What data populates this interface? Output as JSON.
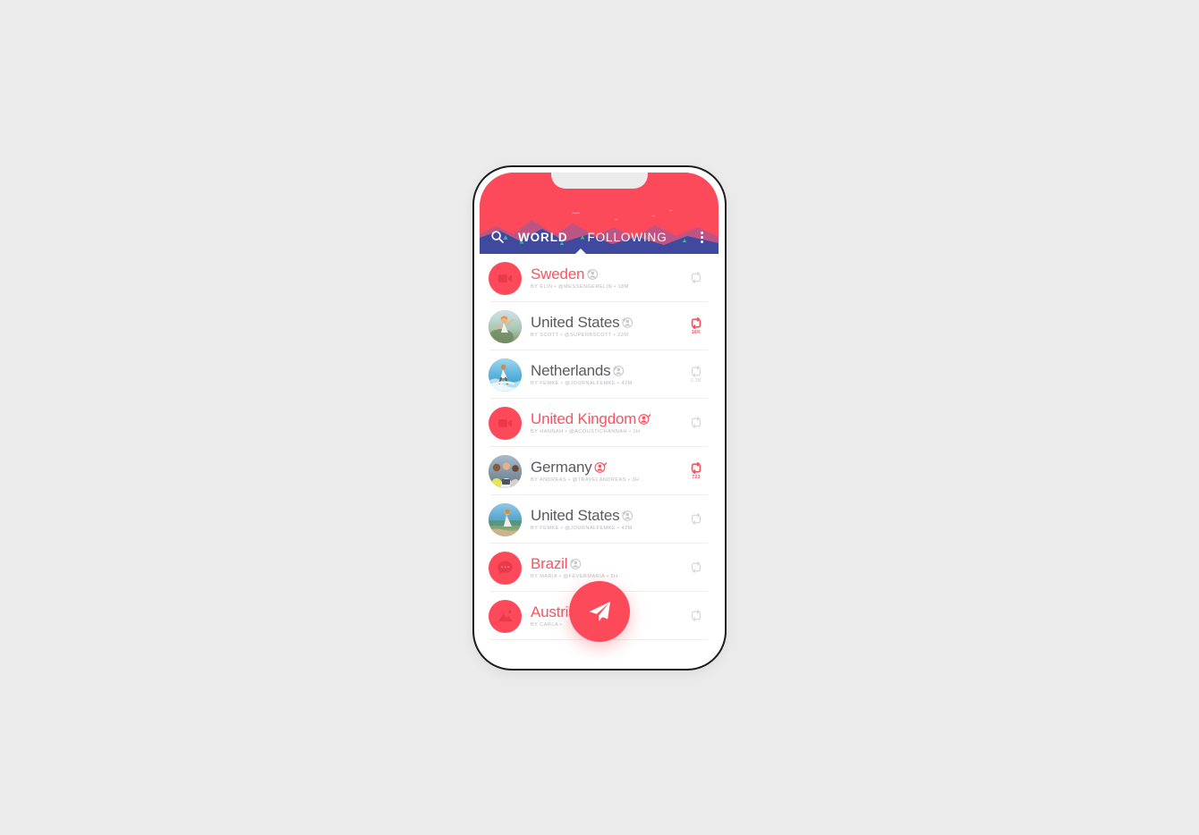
{
  "theme": {
    "accent_red": "#fc4a5a",
    "title_red": "#fc5260",
    "title_grey": "#5b5b5f",
    "subtitle_grey": "#b9b9bd",
    "mountain_back": "#b85c8e",
    "mountain_front": "#3f4a9e",
    "sun": "#f7a64a",
    "page_bg": "#ebebeb"
  },
  "header": {
    "search_icon": "search-icon",
    "more_icon": "more-vertical-icon",
    "tabs": [
      {
        "label": "WORLD",
        "active": true
      },
      {
        "label": "FOLLOWING",
        "active": false
      }
    ]
  },
  "fab": {
    "icon": "paper-plane-icon",
    "label": "Compose"
  },
  "feed": {
    "rows": [
      {
        "title": "Sweden",
        "title_color": "red",
        "avatar_type": "icon",
        "avatar_icon": "video-camera-icon",
        "follow_badge": "add-person-icon",
        "follow_badge_state": "not-following",
        "subtitle": "BY ELIN • @MESSENGERELIN • 18M",
        "author": "ELIN",
        "handle": "@MESSENGERELIN",
        "time": "18M",
        "retweet_active": false,
        "retweet_count": ""
      },
      {
        "title": "United States",
        "title_color": "grey",
        "avatar_type": "photo",
        "avatar_icon": "photo-hiker-avatar",
        "follow_badge": "add-person-icon",
        "follow_badge_state": "not-following",
        "subtitle": "BY SCOTT • @SUPERBSCOTT • 22M",
        "author": "SCOTT",
        "handle": "@SUPERBSCOTT",
        "time": "22M",
        "retweet_active": true,
        "retweet_count": "16K"
      },
      {
        "title": "Netherlands",
        "title_color": "grey",
        "avatar_type": "photo",
        "avatar_icon": "photo-surfer-avatar",
        "follow_badge": "add-person-icon",
        "follow_badge_state": "not-following",
        "subtitle": "BY FEMKE • @JOURNALFEMKE • 42M",
        "author": "FEMKE",
        "handle": "@JOURNALFEMKE",
        "time": "42M",
        "retweet_active": false,
        "retweet_count": "2.2K"
      },
      {
        "title": "United Kingdom",
        "title_color": "red",
        "avatar_type": "icon",
        "avatar_icon": "video-camera-icon",
        "follow_badge": "person-check-icon",
        "follow_badge_state": "following",
        "subtitle": "BY HANNAH • @ACOUSTICHANNAH • 1H",
        "author": "HANNAH",
        "handle": "@ACOUSTICHANNAH",
        "time": "1H",
        "retweet_active": false,
        "retweet_count": ""
      },
      {
        "title": "Germany",
        "title_color": "grey",
        "avatar_type": "photo",
        "avatar_icon": "photo-friends-avatar",
        "follow_badge": "person-check-icon",
        "follow_badge_state": "following",
        "subtitle": "BY ANDREAS • @TRAVELANDREAS • 3H",
        "author": "ANDREAS",
        "handle": "@TRAVELANDREAS",
        "time": "3H",
        "retweet_active": true,
        "retweet_count": "723"
      },
      {
        "title": "United States",
        "title_color": "grey",
        "avatar_type": "photo",
        "avatar_icon": "photo-beach-avatar",
        "follow_badge": "add-person-icon",
        "follow_badge_state": "not-following",
        "subtitle": "BY FEMKE • @JOURNALFEMKE • 42M",
        "author": "FEMKE",
        "handle": "@JOURNALFEMKE",
        "time": "42M",
        "retweet_active": false,
        "retweet_count": ""
      },
      {
        "title": "Brazil",
        "title_color": "red",
        "avatar_type": "icon",
        "avatar_icon": "chat-bubble-icon",
        "follow_badge": "add-person-icon",
        "follow_badge_state": "not-following",
        "subtitle": "BY MARIA • @FEVERMARIA • 5H",
        "author": "MARIA",
        "handle": "@FEVERMARIA",
        "time": "5H",
        "retweet_active": false,
        "retweet_count": ""
      },
      {
        "title": "Austria",
        "title_color": "red",
        "avatar_type": "icon",
        "avatar_icon": "image-mountain-icon",
        "follow_badge": "none",
        "follow_badge_state": "not-following",
        "subtitle": "BY CARLA • ",
        "author": "CARLA",
        "handle": "",
        "time": "",
        "retweet_active": false,
        "retweet_count": ""
      }
    ]
  }
}
